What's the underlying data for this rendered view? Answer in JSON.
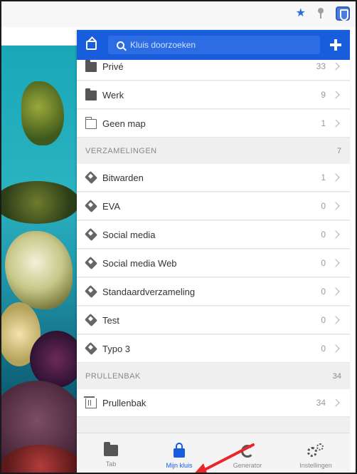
{
  "browser": {
    "extension_icons": [
      "star-icon",
      "pin-icon",
      "bitwarden-extension-icon"
    ]
  },
  "header": {
    "search_placeholder": "Kluis doorzoeken"
  },
  "folders": [
    {
      "label": "Privé",
      "count": "33",
      "icon": "folder-icon"
    },
    {
      "label": "Werk",
      "count": "9",
      "icon": "folder-icon"
    },
    {
      "label": "Geen map",
      "count": "1",
      "icon": "folder-outline-icon"
    }
  ],
  "collections": {
    "title": "VERZAMELINGEN",
    "count": "7",
    "items": [
      {
        "label": "Bitwarden",
        "count": "1"
      },
      {
        "label": "EVA",
        "count": "0"
      },
      {
        "label": "Social media",
        "count": "0"
      },
      {
        "label": "Social media Web",
        "count": "0"
      },
      {
        "label": "Standaardverzameling",
        "count": "0"
      },
      {
        "label": "Test",
        "count": "0"
      },
      {
        "label": "Typo 3",
        "count": "0"
      }
    ]
  },
  "trash": {
    "title": "PRULLENBAK",
    "count": "34",
    "item": {
      "label": "Prullenbak",
      "count": "34"
    }
  },
  "tabs": [
    {
      "label": "Tab",
      "icon": "folder-icon",
      "active": false
    },
    {
      "label": "Mijn kluis",
      "icon": "lock-icon",
      "active": true
    },
    {
      "label": "Generator",
      "icon": "refresh-icon",
      "active": false
    },
    {
      "label": "Instellingen",
      "icon": "gears-icon",
      "active": false
    }
  ],
  "colors": {
    "brand": "#175ddc",
    "annotation": "#e8262b"
  }
}
